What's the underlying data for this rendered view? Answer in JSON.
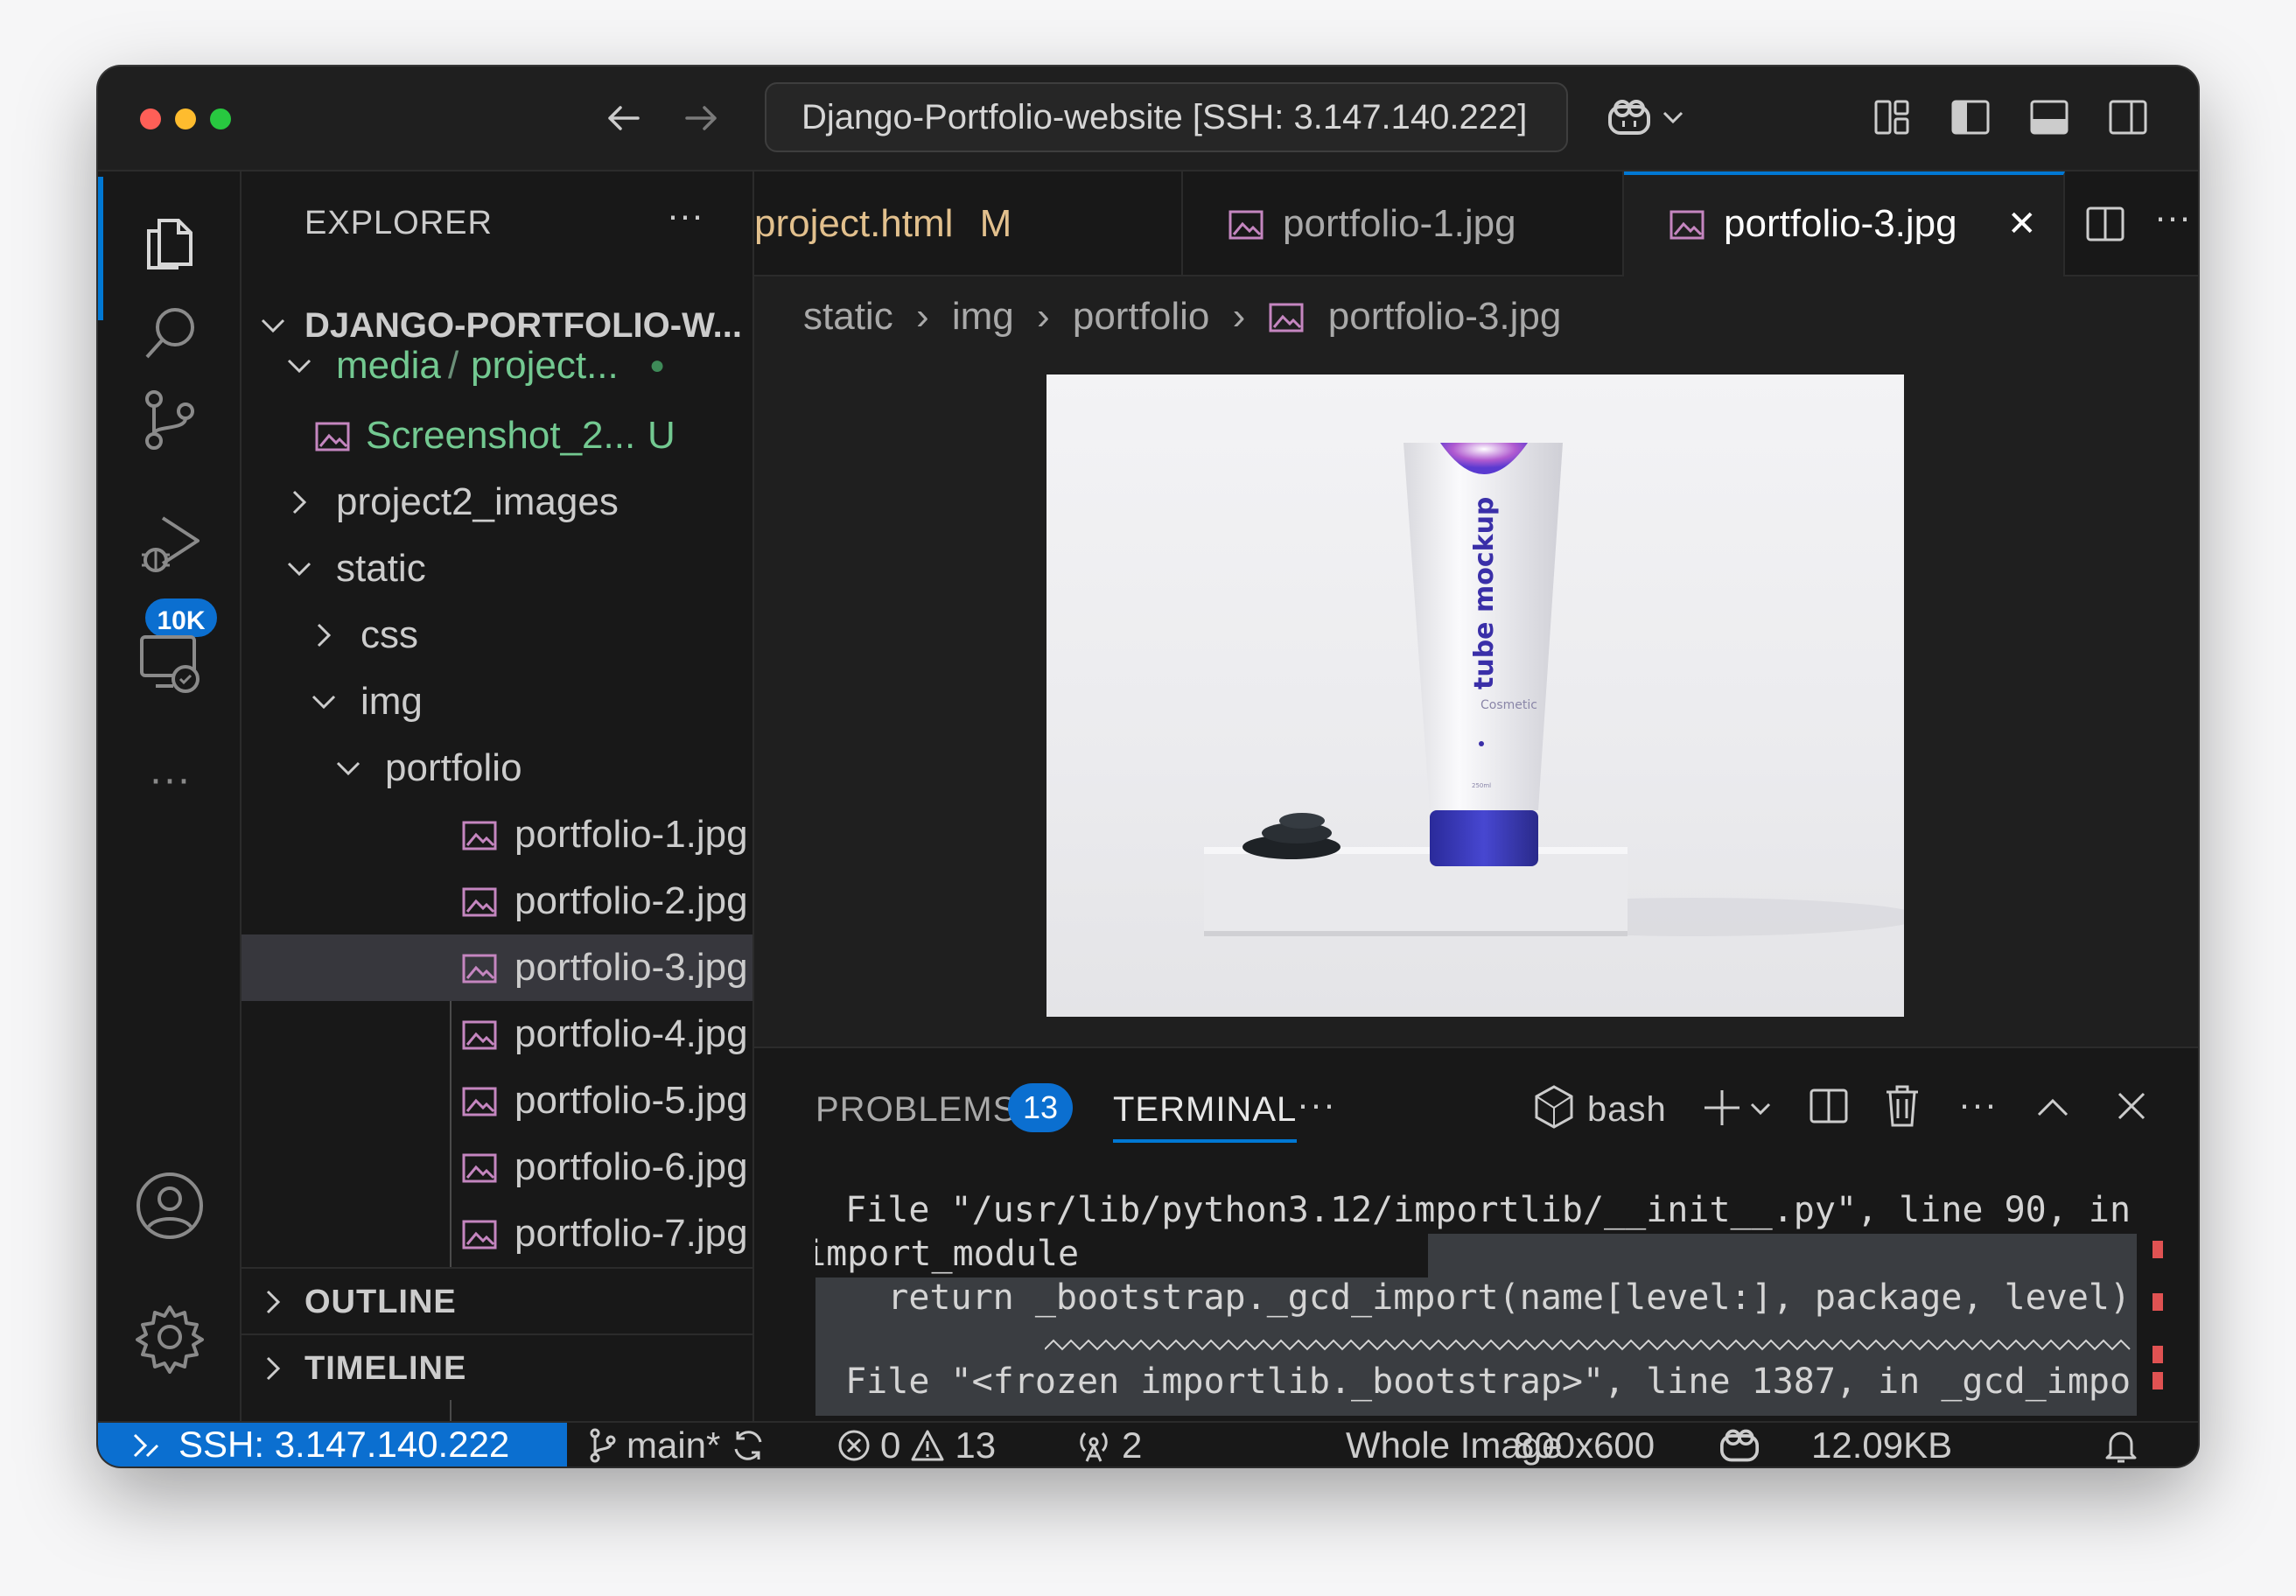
{
  "titlebar": {
    "command_center": "Django-Portfolio-website [SSH: 3.147.140.222]",
    "icons": [
      "back-arrow-icon",
      "forward-arrow-icon",
      "copilot-icon",
      "chevron-down-icon",
      "customize-layout-icon",
      "toggle-sidebar-icon",
      "toggle-panel-icon",
      "toggle-secondary-sidebar-icon"
    ]
  },
  "activitybar": {
    "items": [
      "explorer-icon",
      "search-icon",
      "source-control-icon",
      "run-debug-icon",
      "remote-explorer-icon",
      "more-icon",
      "accounts-icon",
      "settings-gear-icon"
    ],
    "source_control_badge": "10K"
  },
  "sidebar": {
    "header": "EXPLORER",
    "more": "···",
    "root": "DJANGO-PORTFOLIO-W...",
    "tree": [
      {
        "label": "media",
        "sep": "/",
        "label2": "project...",
        "dot": "●"
      },
      {
        "label": "Screenshot_2...",
        "status": "U"
      },
      {
        "label": "project2_images"
      },
      {
        "label": "static"
      },
      {
        "label": "css"
      },
      {
        "label": "img"
      },
      {
        "label": "portfolio"
      },
      {
        "label": "portfolio-1.jpg"
      },
      {
        "label": "portfolio-2.jpg"
      },
      {
        "label": "portfolio-3.jpg"
      },
      {
        "label": "portfolio-4.jpg"
      },
      {
        "label": "portfolio-5.jpg"
      },
      {
        "label": "portfolio-6.jpg"
      },
      {
        "label": "portfolio-7.jpg"
      }
    ],
    "outline": "OUTLINE",
    "timeline": "TIMELINE"
  },
  "tabs": [
    {
      "label": "project.html",
      "status": "M"
    },
    {
      "label": "portfolio-1.jpg"
    },
    {
      "label": "portfolio-3.jpg",
      "close": "✕"
    }
  ],
  "breadcrumb": [
    "static",
    "img",
    "portfolio",
    "portfolio-3.jpg"
  ],
  "preview": {
    "product_text": "tube mockup",
    "product_sub": "Cosmetic",
    "product_volume": "250ml"
  },
  "panel": {
    "problems_label": "PROBLEMS",
    "problems_count": "13",
    "terminal_label": "TERMINAL",
    "more": "···",
    "shell": "bash",
    "terminal_lines": [
      " File \"/usr/lib/python3.12/importlib/__init__.py\", line 90, in",
      "import_module",
      "   return _bootstrap._gcd_import(name[level:], package, level)",
      " File \"<frozen importlib._bootstrap>\", line 1387, in _gcd_impo"
    ]
  },
  "statusbar": {
    "remote": "SSH: 3.147.140.222",
    "branch": "main*",
    "errors": "0",
    "warnings": "13",
    "ports": "2",
    "view_mode": "Whole Image",
    "dimensions": "800x600",
    "size": "12.09KB"
  },
  "colors": {
    "accent": "#0078d4",
    "badge": "#0b6fd0",
    "git_added": "#73c991",
    "git_modified": "#e2c08d",
    "image_icon": "#c586c0"
  }
}
